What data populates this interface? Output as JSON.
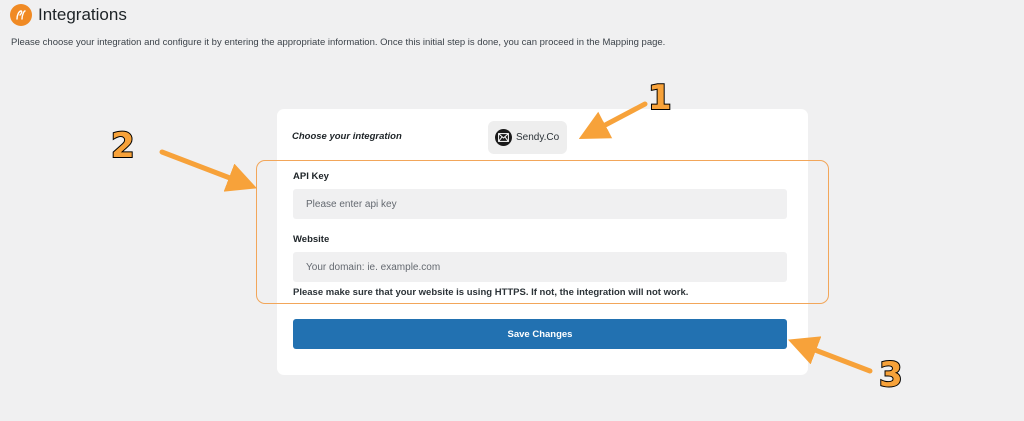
{
  "header": {
    "title": "Integrations",
    "description": "Please choose your integration and configure it by entering the appropriate information. Once this initial step is done, you can proceed in the Mapping page."
  },
  "form": {
    "choose_label": "Choose your integration",
    "integration_name": "Sendy.Co",
    "api_key": {
      "label": "API Key",
      "placeholder": "Please enter api key",
      "value": ""
    },
    "website": {
      "label": "Website",
      "placeholder": "Your domain: ie. example.com",
      "value": ""
    },
    "notice": "Please make sure that your website is using HTTPS. If not, the integration will not work.",
    "save_label": "Save Changes"
  },
  "annotations": [
    {
      "number": "1"
    },
    {
      "number": "2"
    },
    {
      "number": "3"
    }
  ],
  "colors": {
    "accent": "#2271b1",
    "annotation_orange": "#f7a23a",
    "highlight_border": "#f2a65a",
    "logo_orange": "#f08a24"
  },
  "icons": {
    "logo": "plugin-logo-icon",
    "integration": "sendy-envelope-icon"
  }
}
